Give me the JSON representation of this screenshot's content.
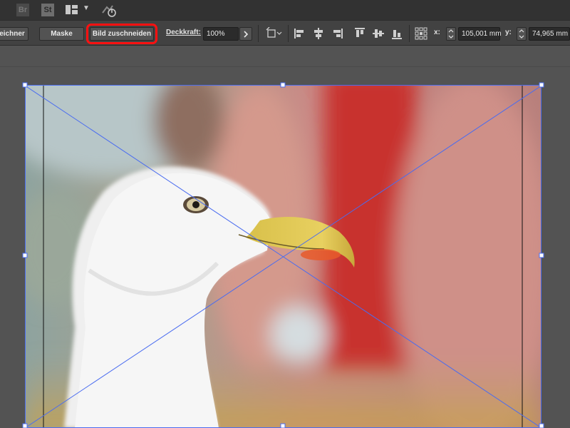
{
  "app_bar": {
    "bridge_label": "Br",
    "stock_label": "St",
    "icons": [
      "bridge-icon",
      "stock-icon",
      "workspace-layout-icon",
      "chevron-down-icon",
      "sync-icon"
    ]
  },
  "control_bar": {
    "sign_button_label": "eichner",
    "mask_button_label": "Maske",
    "crop_button_label": "Bild zuschneiden",
    "opacity_label": "Deckkraft:",
    "opacity_value": "100%",
    "x_label": "x:",
    "x_value": "105,001 mm",
    "y_label": "y:",
    "y_value": "74,965 mm",
    "highlight_color": "#ff1111"
  },
  "frame": {
    "selection_color": "#4a6cf0"
  }
}
